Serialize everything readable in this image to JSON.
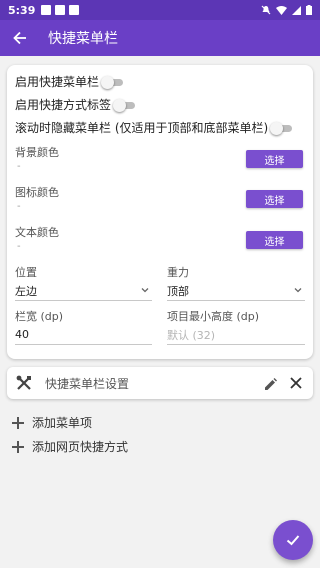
{
  "status_bar": {
    "time": "5:39"
  },
  "app_bar": {
    "title": "快捷菜单栏"
  },
  "switches": [
    {
      "label": "启用快捷菜单栏",
      "on": false
    },
    {
      "label": "启用快捷方式标签",
      "on": false
    },
    {
      "label": "滚动时隐藏菜单栏 (仅适用于顶部和底部菜单栏)",
      "on": false
    }
  ],
  "colors": [
    {
      "label": "背景颜色",
      "value": "-",
      "button": "选择"
    },
    {
      "label": "图标颜色",
      "value": "-",
      "button": "选择"
    },
    {
      "label": "文本颜色",
      "value": "-",
      "button": "选择"
    }
  ],
  "fields": {
    "position": {
      "label": "位置",
      "value": "左边"
    },
    "gravity": {
      "label": "重力",
      "value": "顶部"
    },
    "bar_width": {
      "label": "栏宽 (dp)",
      "value": "40"
    },
    "min_height": {
      "label": "项目最小高度 (dp)",
      "placeholder": "默认 (32)"
    }
  },
  "tools_card": {
    "label": "快捷菜单栏设置"
  },
  "actions": {
    "add_menu_item": "添加菜单项",
    "add_web_shortcut": "添加网页快捷方式"
  },
  "colors_theme": {
    "primary": "#6a3fc6",
    "status": "#5c36b5",
    "accent": "#7a4fcf"
  }
}
